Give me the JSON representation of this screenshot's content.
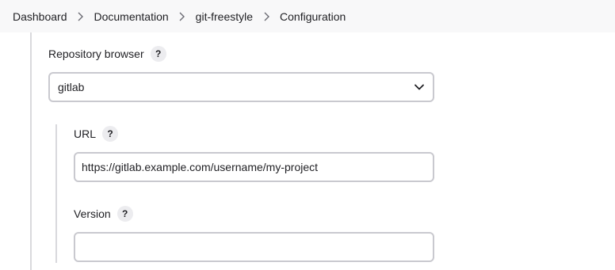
{
  "breadcrumb": {
    "items": [
      "Dashboard",
      "Documentation",
      "git-freestyle",
      "Configuration"
    ]
  },
  "repository_browser": {
    "label": "Repository browser",
    "help": "?",
    "selected": "gitlab",
    "icon": "chevron-down-icon"
  },
  "url_field": {
    "label": "URL",
    "help": "?",
    "value": "https://gitlab.example.com/username/my-project"
  },
  "version_field": {
    "label": "Version",
    "help": "?",
    "value": ""
  },
  "colors": {
    "breadcrumb_bg": "#f8f8f9",
    "border": "#c9c9cf",
    "rail": "#d9d9dd",
    "help_bg": "#ececef"
  }
}
